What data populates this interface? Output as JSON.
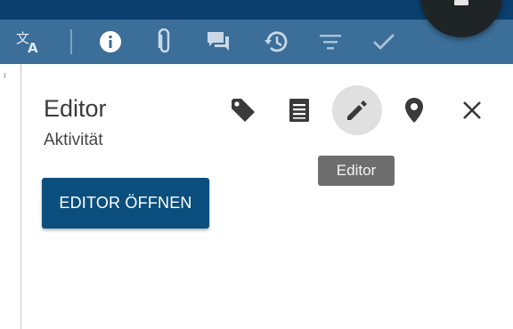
{
  "toolbar": {
    "icons": [
      "translate-icon",
      "info-icon",
      "attachment-icon",
      "comments-icon",
      "history-icon",
      "filter-icon",
      "check-icon"
    ],
    "background_color": "#3b6e99",
    "top_strip_color": "#0b3f6d"
  },
  "panel": {
    "title": "Editor",
    "subtitle": "Aktivität",
    "actions": [
      "tag-icon",
      "document-icon",
      "pencil-icon",
      "location-pin-icon",
      "close-icon"
    ],
    "active_action": "pencil-icon"
  },
  "tooltip": {
    "text": "Editor"
  },
  "primary_button": {
    "label": "EDITOR ÖFFNEN",
    "color": "#0b4f7f"
  }
}
